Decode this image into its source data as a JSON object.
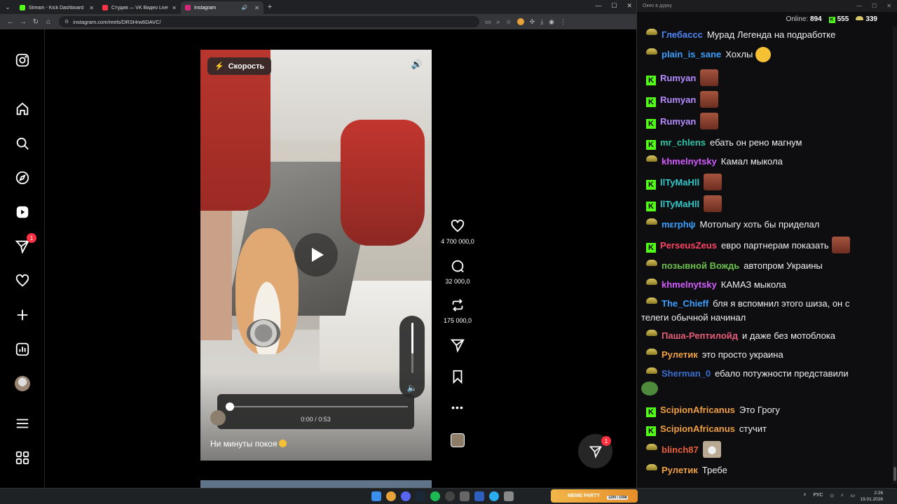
{
  "browser": {
    "tabs": [
      {
        "title": "Stream - Kick Dashboard",
        "color": "#53fc18"
      },
      {
        "title": "Студия — VK Видео Live",
        "color": "#ff3347"
      },
      {
        "title": "Instagram",
        "color": "#d62976"
      }
    ],
    "url": "instagram.com/reels/DRSHrw6DAVC/"
  },
  "instagram": {
    "speed_label": "Скорость",
    "time": "0:00 / 0:53",
    "caption": "Ни минуты покоя",
    "likes": "4 700 000,0",
    "comments": "32 000,0",
    "reposts": "175 000,0",
    "notif_badge": "1",
    "messages_badge": "1",
    "playback_progress": 0
  },
  "chat": {
    "window_title": "Окно в дурку",
    "online_label": "Online:",
    "online": "894",
    "kick_count": "555",
    "hat_count": "339",
    "messages": [
      {
        "badge": "hat",
        "nick": "Глебассс",
        "color": "#4f86f7",
        "text": "Мурад Легенда на подработке"
      },
      {
        "badge": "hat",
        "nick": "plain_is_sane",
        "color": "#3aa0ff",
        "text": "Хохлы",
        "emote": "laugh"
      },
      {
        "badge": "kick",
        "nick": "Rumyan",
        "color": "#b58cff",
        "text": "",
        "emote": "face"
      },
      {
        "badge": "kick",
        "nick": "Rumyan",
        "color": "#b58cff",
        "text": "",
        "emote": "face"
      },
      {
        "badge": "kick",
        "nick": "Rumyan",
        "color": "#b58cff",
        "text": "",
        "emote": "face"
      },
      {
        "badge": "kick",
        "nick": "mr_chlens",
        "color": "#2fc3a8",
        "text": "ебать он рено магнум"
      },
      {
        "badge": "hat",
        "nick": "khmelnytsky",
        "color": "#d35cff",
        "text": "Камал мыкола"
      },
      {
        "badge": "kick",
        "nick": "llTyMaHll",
        "color": "#33c7c7",
        "text": "",
        "emote": "face"
      },
      {
        "badge": "kick",
        "nick": "llTyMaHll",
        "color": "#33c7c7",
        "text": "",
        "emote": "face"
      },
      {
        "badge": "hat",
        "nick": "mεrphψ",
        "color": "#3aa0ff",
        "text": "Мотолыгу хоть бы приделал"
      },
      {
        "badge": "kick",
        "nick": "PerseusZeus",
        "color": "#ff4466",
        "text": "евро партнерам показать",
        "emote": "face"
      },
      {
        "badge": "hat",
        "nick": "позывной Вождь",
        "color": "#6bbf4a",
        "text": "автопром Украины"
      },
      {
        "badge": "hat",
        "nick": "khmelnytsky",
        "color": "#d35cff",
        "text": "КАМАЗ мыкола"
      },
      {
        "badge": "hat",
        "nick": "The_Chieff",
        "color": "#3aa0ff",
        "text": "бля я вспомнил этого шиза, он с",
        "text2": "телеги обычной начинал"
      },
      {
        "badge": "hat",
        "nick": "Паша-Рептилойд",
        "color": "#e65c7a",
        "text": "и даже без мотоблока"
      },
      {
        "badge": "hat",
        "nick": "Рулетик",
        "color": "#f0a040",
        "text": "это просто украина"
      },
      {
        "badge": "hat",
        "nick": "Sherman_0",
        "color": "#3a6fd0",
        "text": "ебало потужности представили",
        "emote2": "pepe"
      },
      {
        "badge": "kick",
        "nick": "ScipionAfricanus",
        "color": "#f0a040",
        "text": "Это Грогу"
      },
      {
        "badge": "kick",
        "nick": "ScipionAfricanus",
        "color": "#f0a040",
        "text": "стучит"
      },
      {
        "badge": "hat",
        "nick": "blinch87",
        "color": "#e8603c",
        "text": "",
        "emote": "cat"
      },
      {
        "badge": "hat",
        "nick": "Рулетик",
        "color": "#f0a040",
        "text": "Требе"
      }
    ]
  },
  "taskbar": {
    "meme_label": "MEME PARTY",
    "meme_stat": "1200 / 1598",
    "lang": "РУС",
    "time": "2:26",
    "date": "19.01.2026"
  }
}
